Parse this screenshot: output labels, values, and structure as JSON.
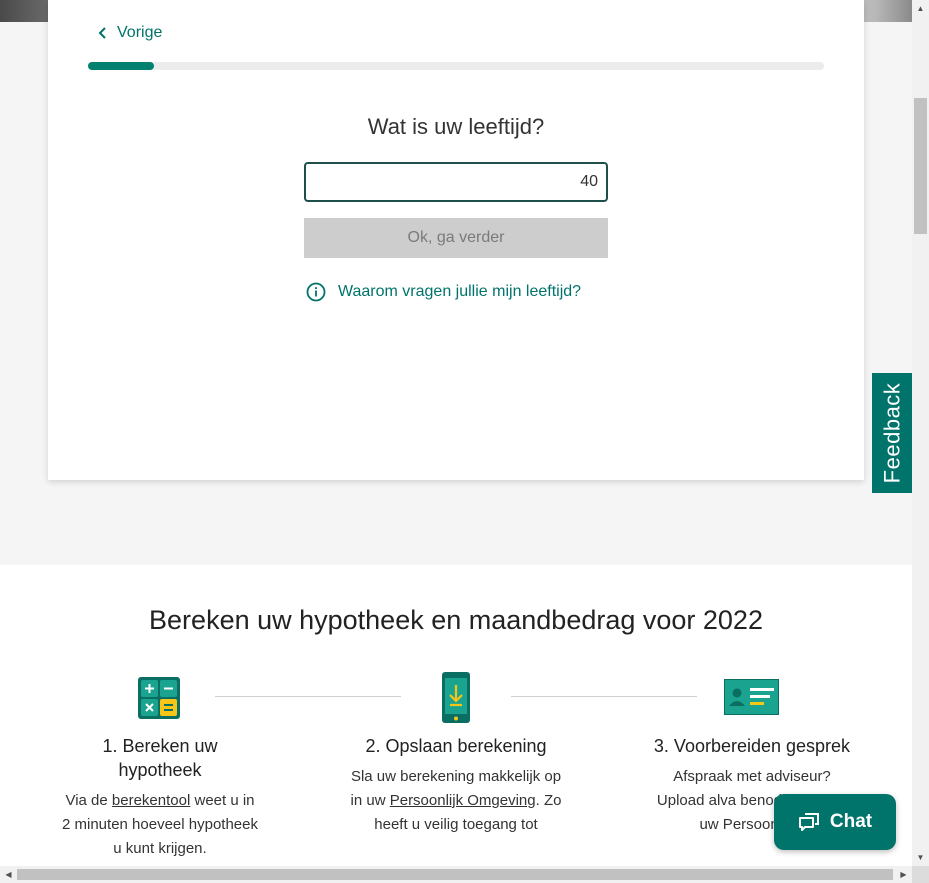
{
  "nav": {
    "back_label": "Vorige"
  },
  "progress": {
    "fraction": 0.09
  },
  "question": {
    "title": "Wat is uw leeftijd?",
    "age_value": "40",
    "submit_label": "Ok, ga verder",
    "why_label": "Waarom vragen jullie mijn leeftijd?"
  },
  "feedback": {
    "label": "Feedback"
  },
  "steps_section": {
    "title": "Bereken uw hypotheek en maandbedrag voor 2022",
    "steps": [
      {
        "title": "1. Bereken uw hypotheek",
        "desc_before": "Via de ",
        "desc_link": "berekentool",
        "desc_after": " weet u in 2 minuten hoeveel hypotheek u kunt krijgen.",
        "icon": "calculator-icon"
      },
      {
        "title": "2. Opslaan berekening",
        "desc_before": "Sla uw berekening makkelijk op in uw ",
        "desc_link": "Persoonlijk Omgeving",
        "desc_after": ". Zo heeft u veilig toegang tot",
        "icon": "phone-download-icon"
      },
      {
        "title": "3. Voorbereiden gesprek",
        "desc_before": "Afspraak met adviseur? Upload alva",
        "desc_link": "",
        "desc_after": " benodigde docu uw Persoonlijke",
        "icon": "id-card-icon"
      }
    ]
  },
  "chat": {
    "label": "Chat"
  },
  "colors": {
    "brand_teal": "#00736a",
    "progress_fill": "#00806f",
    "button_disabled": "#cdcdcd",
    "icon_yellow": "#f5c518"
  }
}
